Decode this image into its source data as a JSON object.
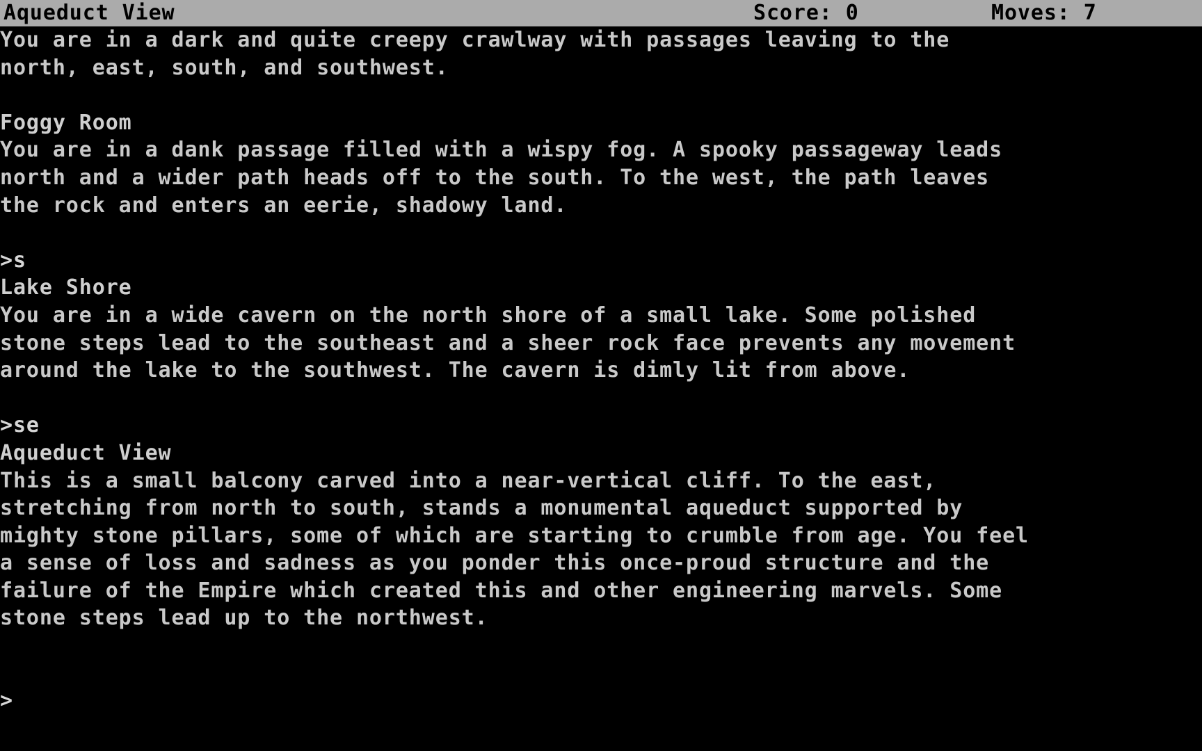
{
  "window": {
    "kind": "interactive-fiction-terminal",
    "background_color": "#000000",
    "text_color": "#c9c9c9",
    "status_bar_color": "#ababab",
    "status_bar_text_color": "#000000"
  },
  "status_bar": {
    "room_name": "Aqueduct View",
    "score_label": "Score: 0",
    "moves_label": "Moves: 7"
  },
  "transcript": {
    "lines": [
      {
        "id": "l01",
        "kind": "body",
        "text": "You are in a dark and quite creepy crawlway with passages leaving to the"
      },
      {
        "id": "l02",
        "kind": "body",
        "text": "north, east, south, and southwest."
      },
      {
        "id": "l03",
        "kind": "blank",
        "text": " "
      },
      {
        "id": "l04",
        "kind": "room-title",
        "text": "Foggy Room"
      },
      {
        "id": "l05",
        "kind": "body",
        "text": "You are in a dank passage filled with a wispy fog. A spooky passageway leads"
      },
      {
        "id": "l06",
        "kind": "body",
        "text": "north and a wider path heads off to the south. To the west, the path leaves"
      },
      {
        "id": "l07",
        "kind": "body",
        "text": "the rock and enters an eerie, shadowy land."
      },
      {
        "id": "l08",
        "kind": "blank",
        "text": " "
      },
      {
        "id": "l09",
        "kind": "prompt",
        "text": ">s"
      },
      {
        "id": "l10",
        "kind": "room-title",
        "text": "Lake Shore"
      },
      {
        "id": "l11",
        "kind": "body",
        "text": "You are in a wide cavern on the north shore of a small lake. Some polished"
      },
      {
        "id": "l12",
        "kind": "body",
        "text": "stone steps lead to the southeast and a sheer rock face prevents any movement"
      },
      {
        "id": "l13",
        "kind": "body",
        "text": "around the lake to the southwest. The cavern is dimly lit from above."
      },
      {
        "id": "l14",
        "kind": "blank",
        "text": " "
      },
      {
        "id": "l15",
        "kind": "prompt",
        "text": ">se"
      },
      {
        "id": "l16",
        "kind": "room-title",
        "text": "Aqueduct View"
      },
      {
        "id": "l17",
        "kind": "body",
        "text": "This is a small balcony carved into a near-vertical cliff. To the east,"
      },
      {
        "id": "l18",
        "kind": "body",
        "text": "stretching from north to south, stands a monumental aqueduct supported by"
      },
      {
        "id": "l19",
        "kind": "body",
        "text": "mighty stone pillars, some of which are starting to crumble from age. You feel"
      },
      {
        "id": "l20",
        "kind": "body",
        "text": "a sense of loss and sadness as you ponder this once-proud structure and the"
      },
      {
        "id": "l21",
        "kind": "body",
        "text": "failure of the Empire which created this and other engineering marvels. Some"
      },
      {
        "id": "l22",
        "kind": "body",
        "text": "stone steps lead up to the northwest."
      },
      {
        "id": "l23",
        "kind": "blank",
        "text": " "
      },
      {
        "id": "l24",
        "kind": "blank",
        "text": " "
      },
      {
        "id": "l25",
        "kind": "prompt",
        "text": ">"
      }
    ]
  },
  "commands_entered": [
    "s",
    "se"
  ],
  "rooms_visited": [
    "Foggy Room",
    "Lake Shore",
    "Aqueduct View"
  ]
}
